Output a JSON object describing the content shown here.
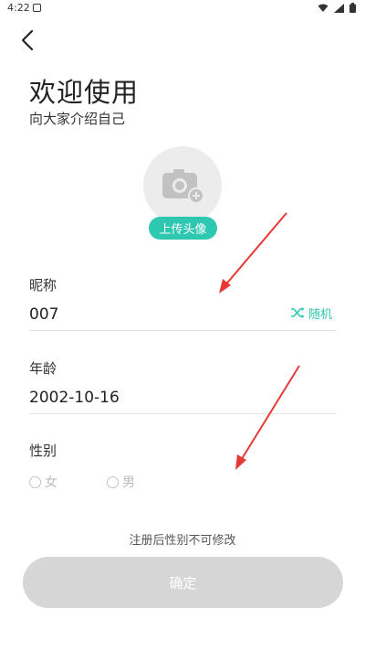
{
  "status_bar": {
    "time": "4:22",
    "notification_icon": "notification-icon",
    "wifi_icon": "wifi-icon",
    "signal_icon": "signal-icon",
    "battery_icon": "battery-icon"
  },
  "header": {
    "back_icon": "chevron-left-icon",
    "title": "欢迎使用",
    "subtitle": "向大家介绍自己"
  },
  "avatar": {
    "camera_icon": "camera-plus-icon",
    "upload_label": "上传头像"
  },
  "form": {
    "nickname": {
      "label": "昵称",
      "value": "007",
      "random_icon": "shuffle-icon",
      "random_label": "随机"
    },
    "age": {
      "label": "年龄",
      "value": "2002-10-16"
    },
    "gender": {
      "label": "性别",
      "options": [
        "女",
        "男"
      ],
      "selected": null
    }
  },
  "footer": {
    "notice": "注册后性别不可修改",
    "confirm_label": "确定"
  },
  "colors": {
    "accent": "#2ec7b0",
    "button_disabled": "#d6d6d6",
    "annotation_arrow": "#e53935"
  }
}
